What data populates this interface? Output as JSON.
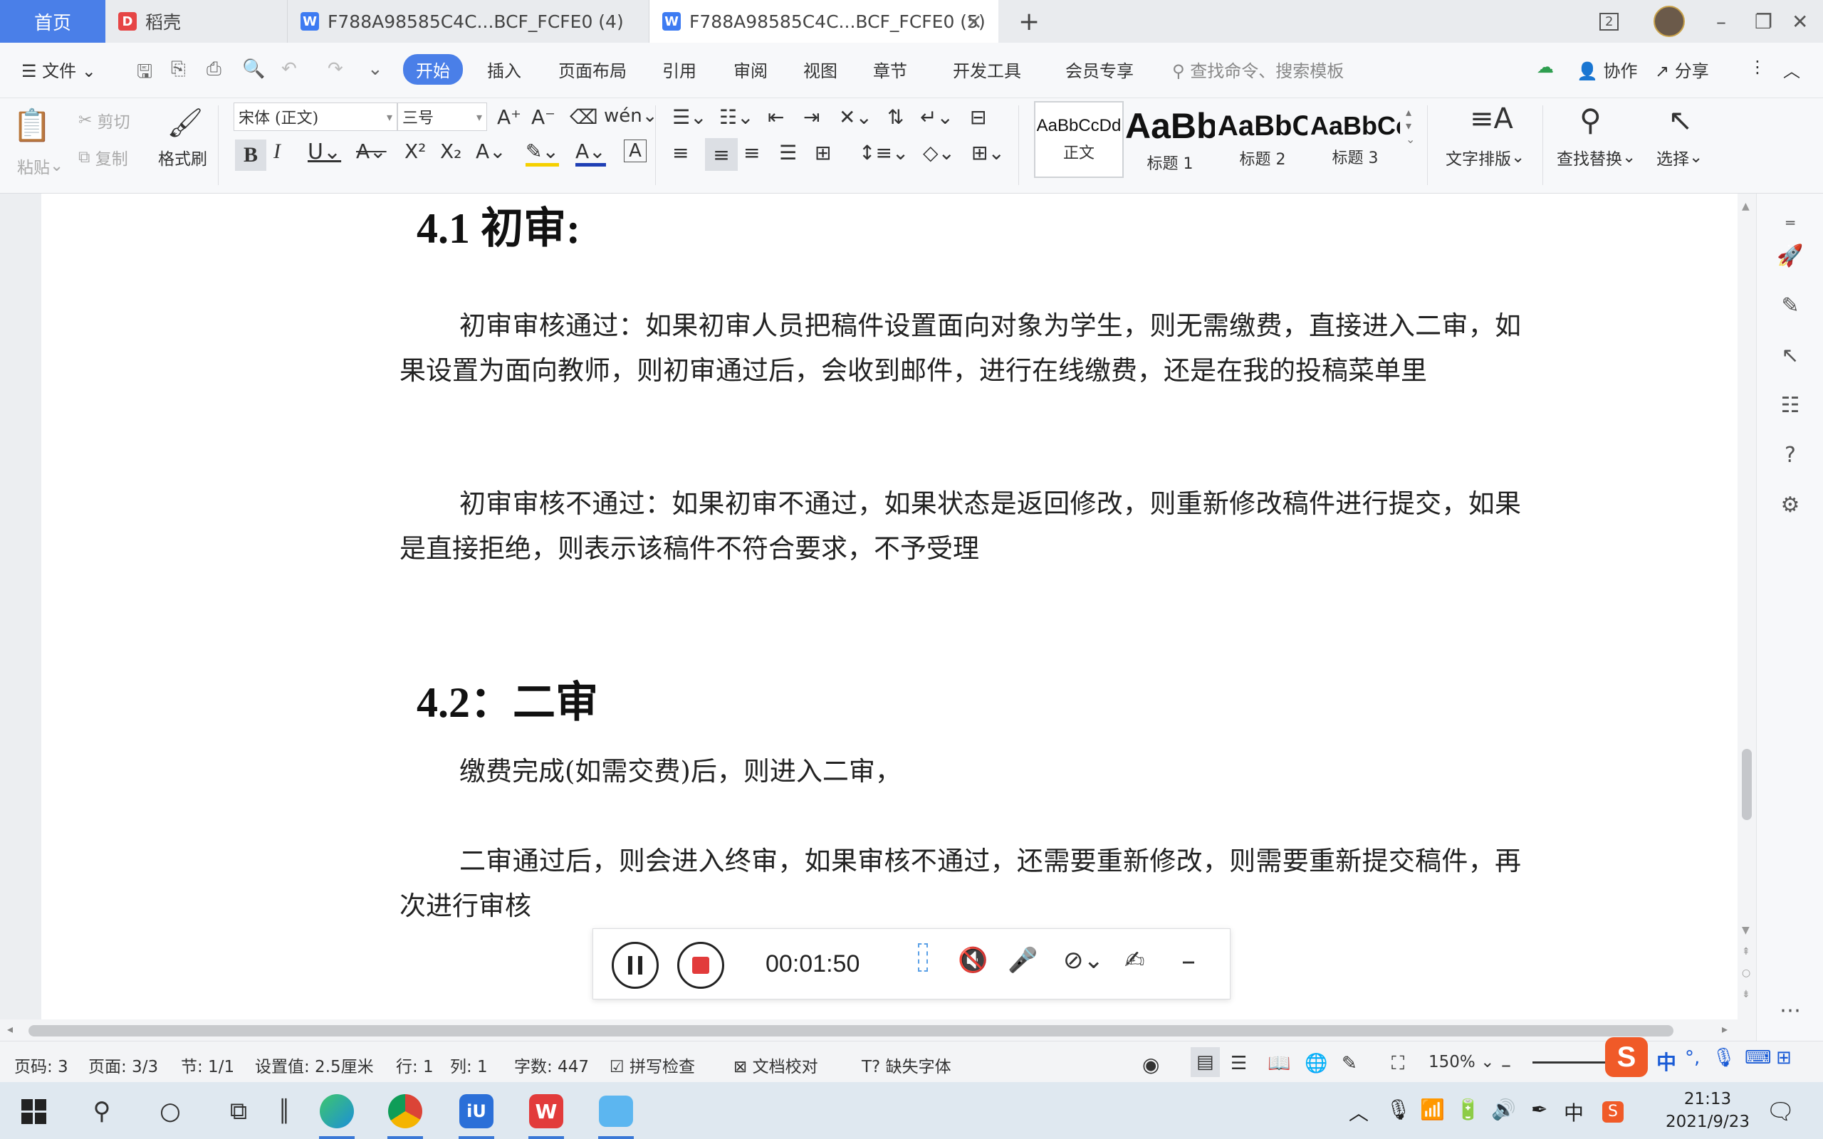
{
  "tabs": {
    "home": "首页",
    "docer": "稻壳",
    "doc4": "F788A98585C4C...BCF_FCFE0 (4)",
    "doc5": "F788A98585C4C...BCF_FCFE0 (5)",
    "new_tab": "+",
    "window_count": "2"
  },
  "menu": {
    "file": "文件",
    "items": [
      "开始",
      "插入",
      "页面布局",
      "引用",
      "审阅",
      "视图",
      "章节",
      "开发工具",
      "会员专享"
    ],
    "search_placeholder": "查找命令、搜索模板",
    "collab": "协作",
    "share": "分享"
  },
  "ribbon": {
    "paste": "粘贴",
    "cut": "剪切",
    "copy": "复制",
    "format_painter": "格式刷",
    "font_name": "宋体 (正文)",
    "font_size": "三号",
    "styles": [
      {
        "sample": "AaBbCcDd",
        "name": "正文"
      },
      {
        "sample": "AaBb",
        "name": "标题 1"
      },
      {
        "sample": "AaBbC",
        "name": "标题 2"
      },
      {
        "sample": "AaBbCc",
        "name": "标题 3"
      }
    ],
    "text_layout": "文字排版",
    "find_replace": "查找替换",
    "select": "选择"
  },
  "document": {
    "heading1": "4.1 初审:",
    "para1": "初审审核通过：如果初审人员把稿件设置面向对象为学生，则无需缴费，直接进入二审，如果设置为面向教师，则初审通过后，会收到邮件，进行在线缴费，还是在我的投稿菜单里",
    "para2": "初审审核不通过：如果初审不通过，如果状态是返回修改，则重新修改稿件进行提交，如果是直接拒绝，则表示该稿件不符合要求，不予受理",
    "heading2": "4.2：二审",
    "para3": "缴费完成(如需交费)后，则进入二审，",
    "para4": "二审通过后，则会进入终审，如果审核不通过，还需要重新修改，则需要重新提交稿件，再次进行审核"
  },
  "recorder": {
    "time": "00:01:50"
  },
  "status": {
    "page_num": "页码: 3",
    "pages": "页面: 3/3",
    "section": "节: 1/1",
    "setting": "设置值: 2.5厘米",
    "row": "行: 1",
    "col": "列: 1",
    "words": "字数: 447",
    "spell": "拼写检查",
    "proof": "文档校对",
    "missing_font": "缺失字体",
    "zoom": "150%"
  },
  "taskbar": {
    "time": "21:13",
    "date": "2021/9/23",
    "ime": "中"
  },
  "colors": {
    "accent": "#4a7fe8",
    "wps_red": "#e64545",
    "sogou": "#f05a28"
  }
}
